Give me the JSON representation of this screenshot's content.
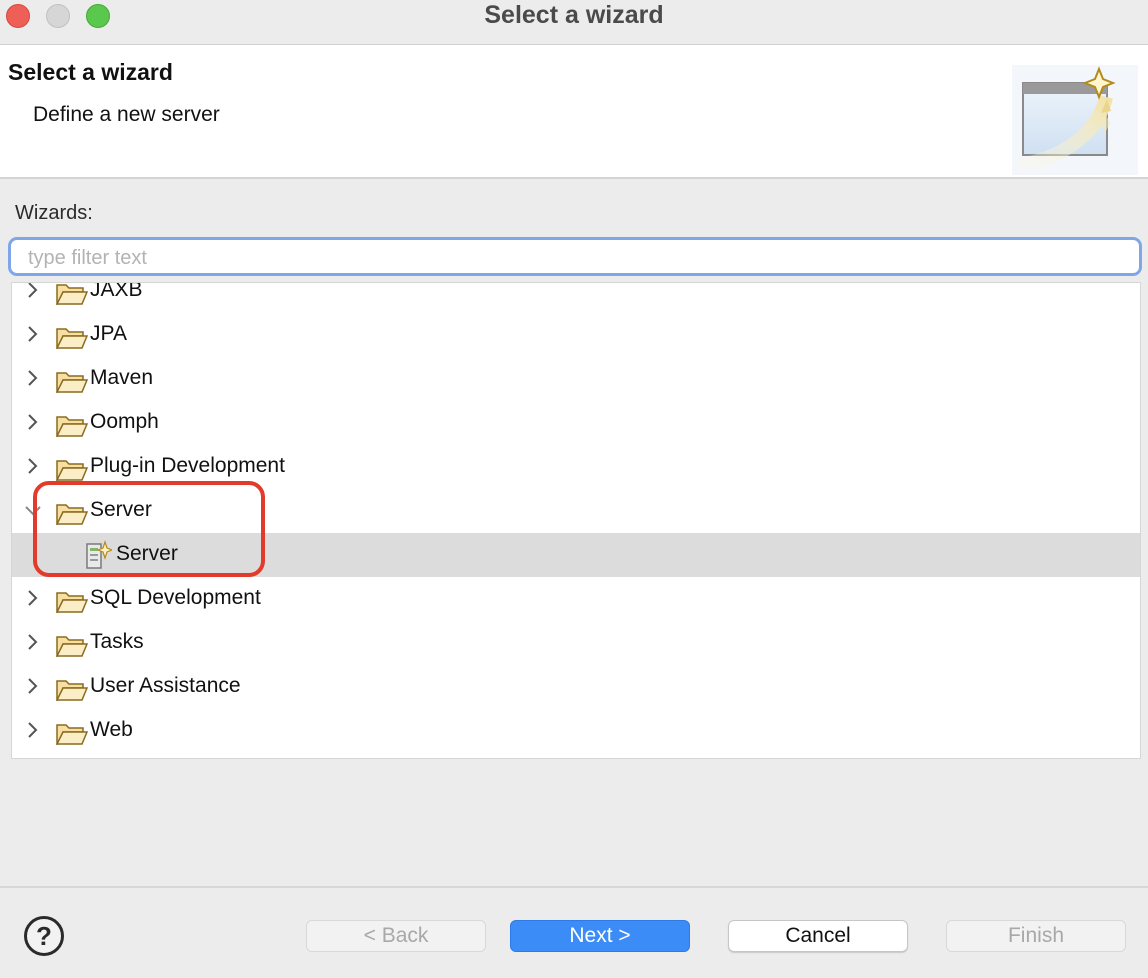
{
  "window": {
    "title": "Select a wizard"
  },
  "header": {
    "title": "Select a wizard",
    "description": "Define a new server"
  },
  "wizards": {
    "label": "Wizards:",
    "filter_placeholder": "type filter text",
    "filter_value": ""
  },
  "tree": {
    "items": [
      {
        "label": "JAXB",
        "expanded": false,
        "icon": "folder-icon"
      },
      {
        "label": "JPA",
        "expanded": false,
        "icon": "folder-icon"
      },
      {
        "label": "Maven",
        "expanded": false,
        "icon": "folder-icon"
      },
      {
        "label": "Oomph",
        "expanded": false,
        "icon": "folder-icon"
      },
      {
        "label": "Plug-in Development",
        "expanded": false,
        "icon": "folder-icon"
      },
      {
        "label": "Server",
        "expanded": true,
        "icon": "folder-icon"
      },
      {
        "label": "Server",
        "child": true,
        "selected": true,
        "icon": "server-wizard-icon"
      },
      {
        "label": "SQL Development",
        "expanded": false,
        "icon": "folder-icon"
      },
      {
        "label": "Tasks",
        "expanded": false,
        "icon": "folder-icon"
      },
      {
        "label": "User Assistance",
        "expanded": false,
        "icon": "folder-icon"
      },
      {
        "label": "Web",
        "expanded": false,
        "icon": "folder-icon"
      }
    ]
  },
  "buttons": {
    "help": "?",
    "back": "< Back",
    "next": "Next >",
    "cancel": "Cancel",
    "finish": "Finish"
  },
  "colors": {
    "accent": "#3b8cf6",
    "highlight": "#e23b2b",
    "selection": "#dcdcdc",
    "focus_ring": "#7fa6e8"
  }
}
